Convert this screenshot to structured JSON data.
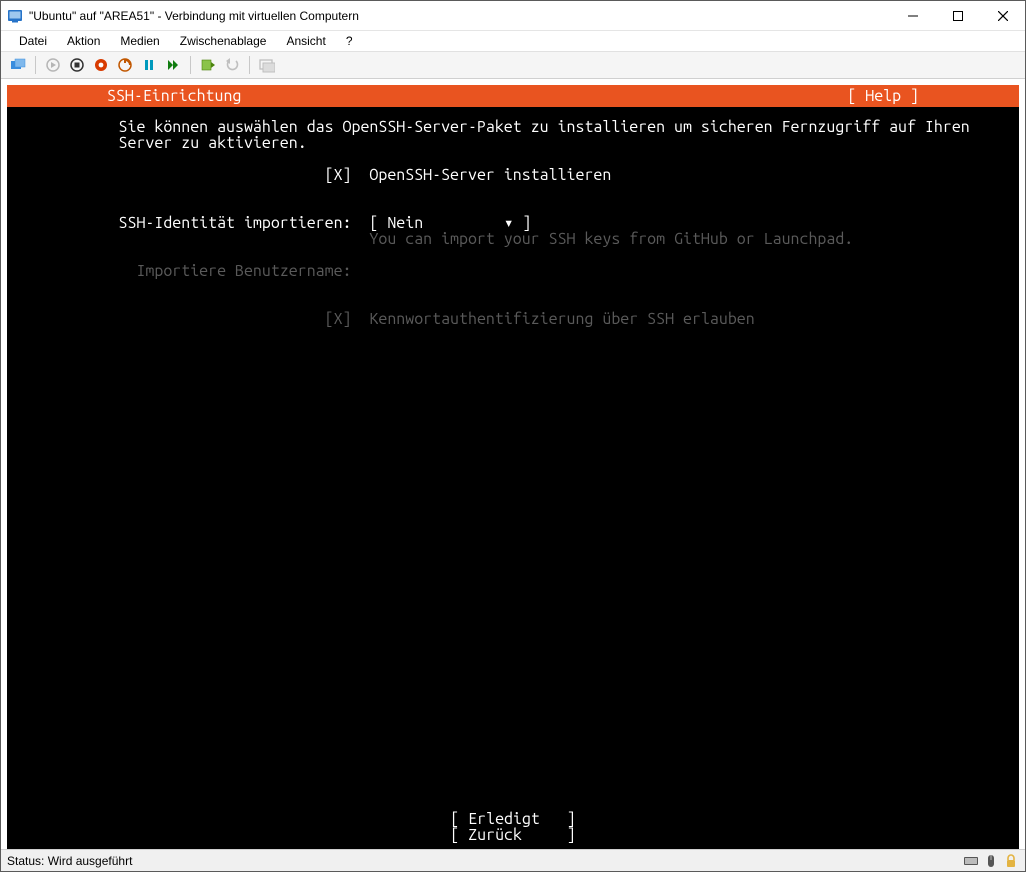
{
  "window": {
    "title": "\"Ubuntu\" auf \"AREA51\" - Verbindung mit virtuellen Computern"
  },
  "menu": {
    "items": [
      "Datei",
      "Aktion",
      "Medien",
      "Zwischenablage",
      "Ansicht",
      "?"
    ]
  },
  "installer": {
    "header_title": "SSH-Einrichtung",
    "help_label": "[ Help ]",
    "intro_line1": "Sie können auswählen das OpenSSH-Server-Paket zu installieren um sicheren Fernzugriff auf Ihren",
    "intro_line2": "Server zu aktivieren.",
    "opt1_box": "[X]",
    "opt1_label": "OpenSSH-Server installieren",
    "identity_label": "SSH-Identität importieren:",
    "identity_select": "[ Nein         ▾ ]",
    "identity_hint": "You can import your SSH keys from GitHub or Launchpad.",
    "username_label": "Importiere Benutzername:",
    "opt2_box": "[X]",
    "opt2_label": "Kennwortauthentifizierung über SSH erlauben",
    "done_btn": "[ Erledigt   ]",
    "back_btn": "[ Zurück     ]"
  },
  "status": {
    "label": "Status:",
    "value": "Wird ausgeführt"
  }
}
